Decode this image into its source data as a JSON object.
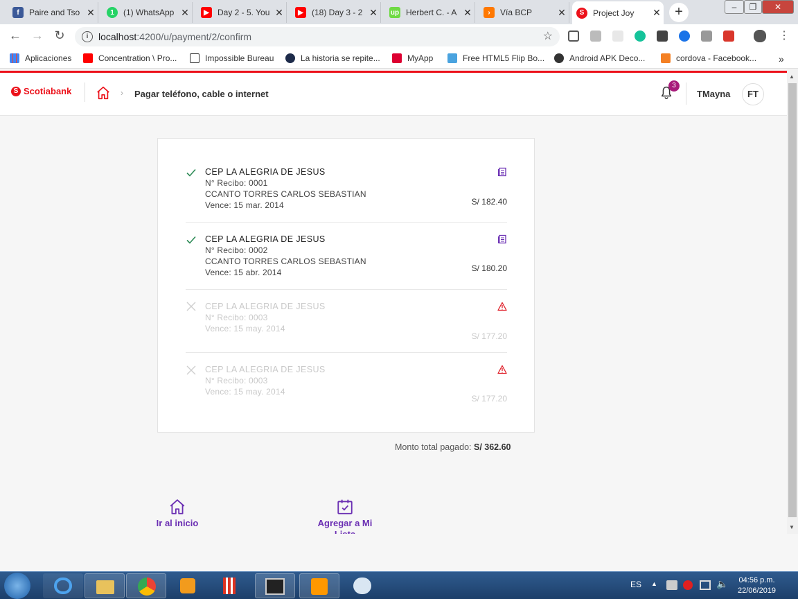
{
  "browser": {
    "tabs": [
      {
        "title": "Paire and Tso",
        "icon": "facebook-icon",
        "color": "#3b5998"
      },
      {
        "title": "(1) WhatsApp",
        "icon": "whatsapp-icon",
        "color": "#25d366"
      },
      {
        "title": "Day 2 - 5. You",
        "icon": "youtube-icon",
        "color": "#ff0000"
      },
      {
        "title": "(18) Day 3 - 2",
        "icon": "youtube-icon",
        "color": "#ff0000"
      },
      {
        "title": "Herbert C. - A",
        "icon": "upwork-icon",
        "color": "#6fda44"
      },
      {
        "title": "Vía BCP",
        "icon": "bcp-icon",
        "color": "#ff7800"
      },
      {
        "title": "Project Joy",
        "icon": "scotiabank-icon",
        "color": "#ec111a"
      }
    ],
    "url_host": "localhost",
    "url_path": ":4200/u/payment/2/confirm",
    "bookmarks": [
      {
        "label": "Aplicaciones",
        "icon": "apps-grid-icon"
      },
      {
        "label": "Concentration \\ Pro...",
        "icon": "youtube-icon"
      },
      {
        "label": "Impossible Bureau",
        "icon": "layers-icon"
      },
      {
        "label": "La historia se repite...",
        "icon": "e-icon"
      },
      {
        "label": "MyApp",
        "icon": "angular-icon"
      },
      {
        "label": "Free HTML5 Flip Bo...",
        "icon": "flip-icon"
      },
      {
        "label": "Android APK Deco...",
        "icon": "github-icon"
      },
      {
        "label": "cordova - Facebook...",
        "icon": "stackoverflow-icon"
      }
    ],
    "more_bookmarks": "»"
  },
  "app": {
    "brand": "Scotiabank",
    "breadcrumb": "Pagar teléfono, cable o internet",
    "notifications": "3",
    "user_name": "TMayna",
    "user_initials": "FT"
  },
  "payments": [
    {
      "status": "ok",
      "company": "CEP LA ALEGRIA DE JESUS",
      "receipt": "N° Recibo: 0001",
      "holder": "CCANTO TORRES CARLOS SEBASTIAN",
      "due": "Vence: 15 mar. 2014",
      "amount": "S/ 182.40"
    },
    {
      "status": "ok",
      "company": "CEP LA ALEGRIA DE JESUS",
      "receipt": "N° Recibo: 0002",
      "holder": "CCANTO TORRES CARLOS SEBASTIAN",
      "due": "Vence: 15 abr. 2014",
      "amount": "S/ 180.20"
    },
    {
      "status": "error",
      "company": "CEP LA ALEGRIA DE JESUS",
      "receipt": "N° Recibo: 0003",
      "holder": "",
      "due": "Vence: 15 may. 2014",
      "amount": "S/ 177.20"
    },
    {
      "status": "error",
      "company": "CEP LA ALEGRIA DE JESUS",
      "receipt": "N° Recibo: 0003",
      "holder": "",
      "due": "Vence: 15 may. 2014",
      "amount": "S/ 177.20"
    }
  ],
  "total": {
    "label": "Monto total pagado:",
    "value": "S/ 362.60"
  },
  "actions": {
    "home": "Ir al inicio",
    "add_list": "Agregar a Mi Lista"
  },
  "taskbar": {
    "lang": "ES",
    "time": "04:56 p.m.",
    "date": "22/06/2019"
  },
  "colors": {
    "brand_red": "#ec111a",
    "accent_purple": "#6b2fb3",
    "ok_green": "#2e8b57",
    "error_red": "#e0202a"
  }
}
